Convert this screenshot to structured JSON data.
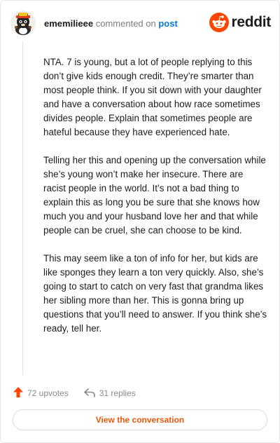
{
  "header": {
    "username": "ememilieee",
    "commented_text": "commented on",
    "post_link": "post",
    "brand_name": "reddit",
    "avatar_icon": "cat-avatar-icon",
    "brand_icon": "reddit-snoo-icon"
  },
  "comment": {
    "paragraphs": [
      "NTA. 7 is young, but a lot of people replying to this don’t give kids enough credit. They’re smarter than most people think. If you sit down with your daughter and have a conversation about how race sometimes divides people. Explain that sometimes people are hateful because they have experienced hate.",
      "Telling her this and opening up the conversation while she’s young won’t make her insecure. There are racist people in the world. It’s not a bad thing to explain this as long you be sure that she knows how much you and your husband love her and that while people can be cruel, she can choose to be kind.",
      "This may seem like a ton of info for her, but kids are like sponges they learn a ton very quickly. Also, she’s going to start to catch on very fast that grandma likes her sibling more than her. This is gonna bring up questions that you’ll need to answer. If you think she’s ready, tell her."
    ]
  },
  "actions": {
    "upvotes": "72 upvotes",
    "replies": "31 replies",
    "upvote_icon": "upvote-arrow-icon",
    "reply_icon": "reply-arrow-icon"
  },
  "footer": {
    "view_button": "View the conversation"
  },
  "colors": {
    "brand": "#ff4500",
    "link": "#0079d3",
    "button_text": "#e8590c"
  }
}
